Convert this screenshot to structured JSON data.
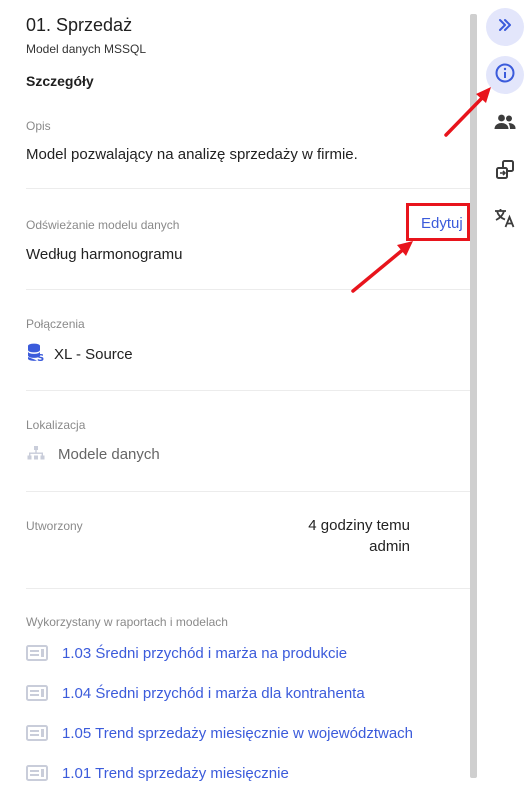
{
  "header": {
    "title": "01. Sprzedaż",
    "subtitle": "Model danych MSSQL",
    "section": "Szczegóły"
  },
  "description": {
    "label": "Opis",
    "value": "Model pozwalający na analizę sprzedaży w firmie."
  },
  "refresh": {
    "label": "Odświeżanie modelu danych",
    "value": "Według harmonogramu",
    "edit_label": "Edytuj"
  },
  "connections": {
    "label": "Połączenia",
    "items": [
      {
        "name": "XL - Source",
        "icon": "database-icon"
      }
    ]
  },
  "location": {
    "label": "Lokalizacja",
    "value": "Modele danych",
    "icon": "hierarchy-icon"
  },
  "created": {
    "label": "Utworzony",
    "when": "4 godziny temu",
    "by": "admin"
  },
  "used_in": {
    "label": "Wykorzystany w raportach i modelach",
    "items": [
      {
        "label": "1.03 Średni przychód i marża na produkcie",
        "icon": "report-icon"
      },
      {
        "label": "1.04 Średni przychód i marża dla kontrahenta",
        "icon": "report-icon"
      },
      {
        "label": "1.05 Trend sprzedaży miesięcznie w województwach",
        "icon": "report-icon"
      },
      {
        "label": "1.01 Trend sprzedaży miesięcznie",
        "icon": "report-icon"
      }
    ]
  },
  "right_rail": {
    "items": [
      "collapse-icon",
      "info-icon",
      "people-icon",
      "share-icon",
      "translate-icon"
    ],
    "active": "info-icon"
  },
  "colors": {
    "accent": "#3b5bdb",
    "annotation": "#e8141c",
    "active_bg": "#e3e6fb",
    "icon_gray": "#c9cdda"
  }
}
